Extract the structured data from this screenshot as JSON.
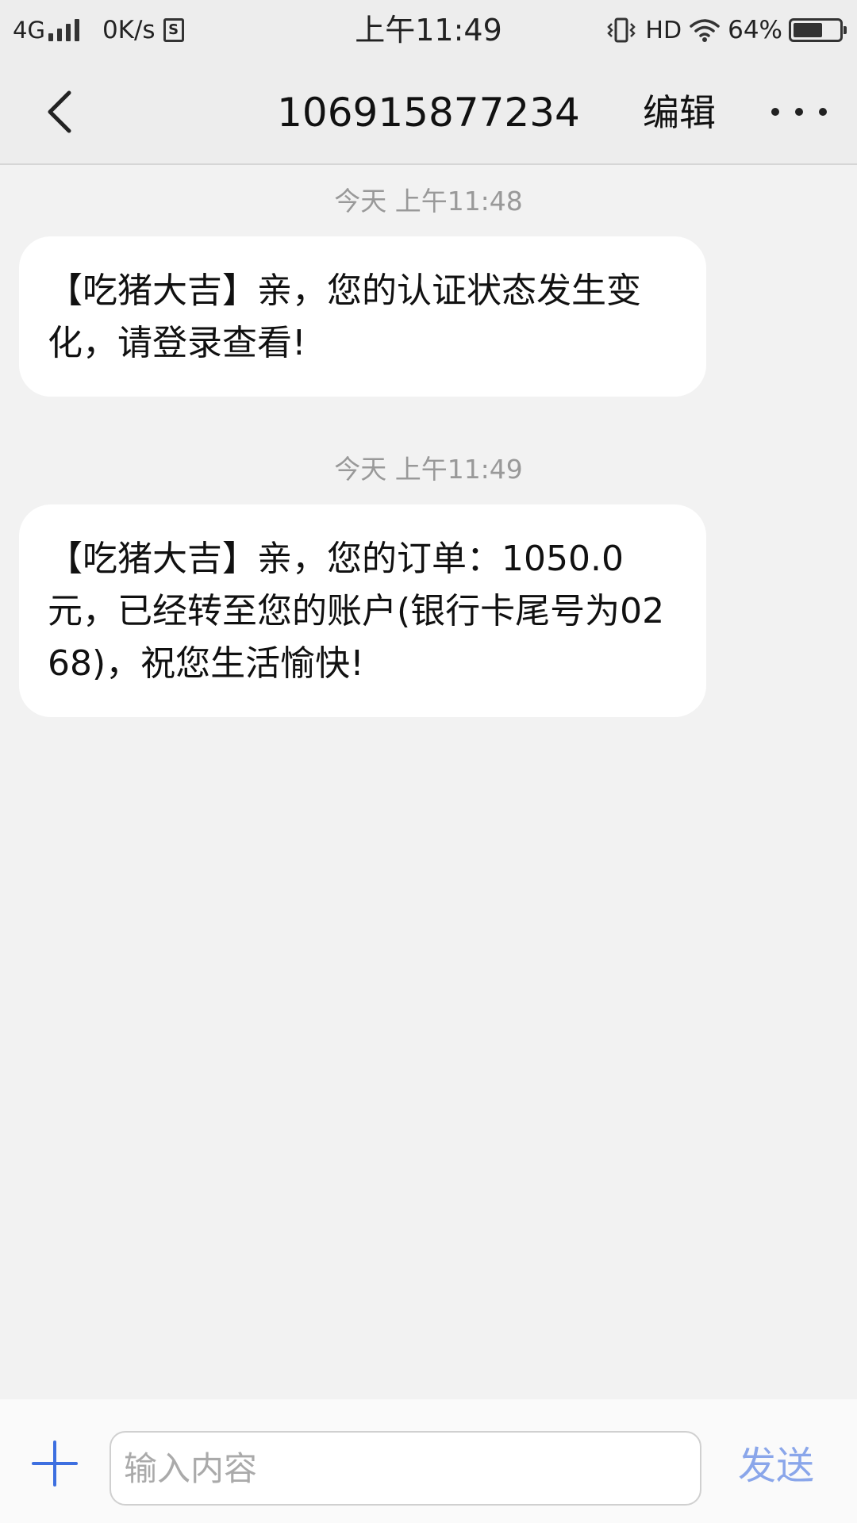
{
  "status_bar": {
    "network": "4G",
    "speed": "0K/s",
    "sim_badge": "S",
    "time": "上午11:49",
    "hd": "HD",
    "battery_percent": "64%",
    "battery_level": 0.64
  },
  "header": {
    "title": "106915877234",
    "edit_label": "编辑"
  },
  "messages": [
    {
      "timestamp": "今天 上午11:48",
      "text": "【吃猪大吉】亲，您的认证状态发生变化，请登录查看!"
    },
    {
      "timestamp": "今天 上午11:49",
      "text": "【吃猪大吉】亲，您的订单：1050.0元，已经转至您的账户(银行卡尾号为0268)，祝您生活愉快!"
    }
  ],
  "composer": {
    "placeholder": "输入内容",
    "send_label": "发送"
  },
  "colors": {
    "accent": "#3d6fe0",
    "send_disabled": "#8aa6ea",
    "background": "#f2f2f2",
    "bubble": "#ffffff"
  },
  "icons": {
    "back": "chevron-left-icon",
    "more": "more-horizontal-icon",
    "add": "plus-icon",
    "signal": "signal-icon",
    "wifi": "wifi-icon",
    "vibrate": "vibrate-icon",
    "battery": "battery-icon",
    "sim": "sim-icon"
  }
}
